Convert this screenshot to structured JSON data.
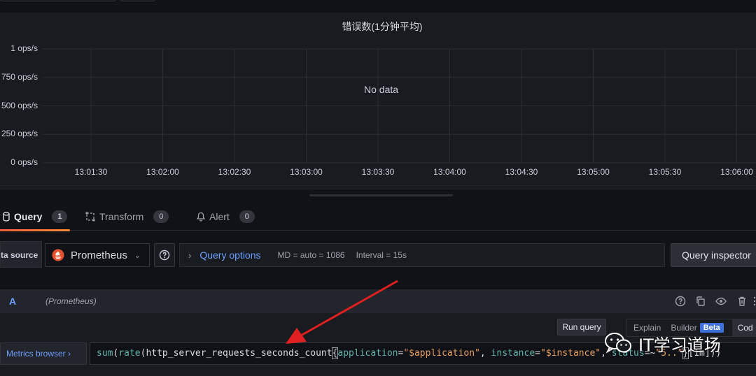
{
  "panel": {
    "title": "错误数(1分钟平均)",
    "no_data": "No data"
  },
  "chart_data": {
    "type": "line",
    "title": "错误数(1分钟平均)",
    "y_tick_labels": [
      "1 ops/s",
      "750 ops/s",
      "500 ops/s",
      "250 ops/s",
      "0 ops/s"
    ],
    "x_tick_labels": [
      "13:01:30",
      "13:02:00",
      "13:02:30",
      "13:03:00",
      "13:03:30",
      "13:04:00",
      "13:04:30",
      "13:05:00",
      "13:05:30",
      "13:06:00"
    ],
    "ylim": [
      0,
      1
    ],
    "series": [],
    "grid": true,
    "annotation": "No data"
  },
  "tabs": [
    {
      "label": "Query",
      "count": "1",
      "icon": "database-icon",
      "active": true
    },
    {
      "label": "Transform",
      "count": "0",
      "icon": "transform-icon",
      "active": false
    },
    {
      "label": "Alert",
      "count": "0",
      "icon": "bell-icon",
      "active": false
    }
  ],
  "datasource": {
    "label": "ta source",
    "selected": "Prometheus",
    "accent": "#e6522c"
  },
  "query_options": {
    "title": "Query options",
    "md": "MD = auto = 1086",
    "interval": "Interval = 15s"
  },
  "inspector_label": "Query inspector",
  "query_row": {
    "ref_id": "A",
    "datasource_name": "(Prometheus)"
  },
  "editor": {
    "run_label": "Run query",
    "explain_label": "Explain",
    "builder_label": "Builder",
    "beta_label": "Beta",
    "code_label": "Cod",
    "metrics_browser_label": "Metrics browser ›",
    "tokens": {
      "t1": "sum",
      "t2": "(",
      "t3": "rate",
      "t4": "(",
      "t5": "http_server_requests_seconds_count",
      "t6": "{",
      "t7": "application",
      "t8": "=",
      "t9": "\"$application\"",
      "t10": ", ",
      "t11": "instance",
      "t12": "=",
      "t13": "\"$instance\"",
      "t14": ", ",
      "t15": "status",
      "t16": "=~",
      "t17": "\"5..\"",
      "t18": "}",
      "t19": "[1m]",
      "t20": "))"
    }
  },
  "watermark": {
    "text": "IT学习道场"
  },
  "colors": {
    "accent_blue": "#6e9fff",
    "active_tab_underline": "#f55f3e",
    "annotation_arrow": "#e02020"
  }
}
